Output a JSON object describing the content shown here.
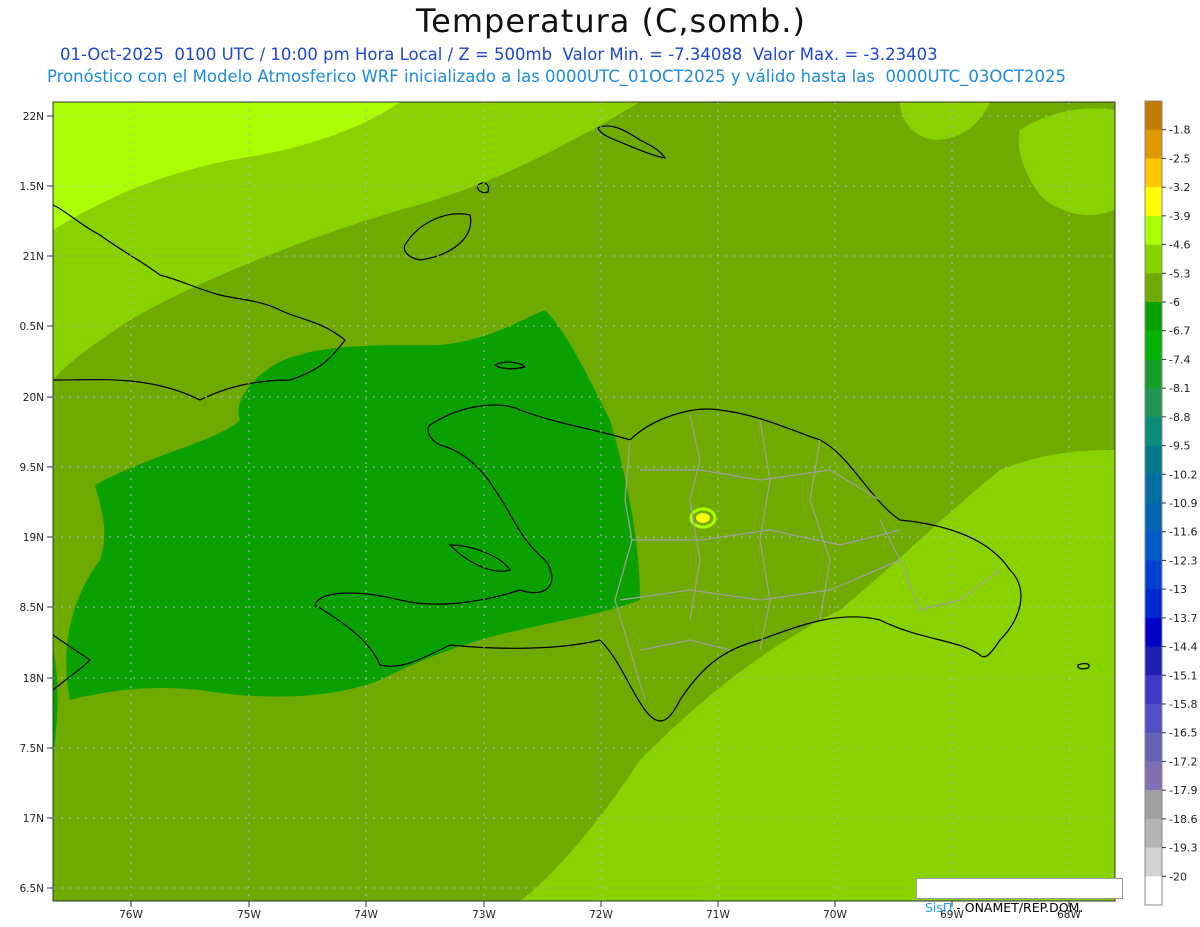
{
  "header": {
    "title": "Temperatura (C,somb.)",
    "line1": "01-Oct-2025  0100 UTC / 10:00 pm Hora Local / Z = 500mb  Valor Min. = -7.34088  Valor Max. = -3.23403",
    "line2": "Pronóstico con el Modelo Atmosferico WRF inicializado a las 0000UTC_01OCT2025 y válido hasta las  0000UTC_03OCT2025"
  },
  "lat_labels": [
    "22N",
    "1.5N",
    "21N",
    "0.5N",
    "20N",
    "9.5N",
    "19N",
    "8.5N",
    "18N",
    "7.5N",
    "17N",
    "6.5N"
  ],
  "lon_labels": [
    "76W",
    "75W",
    "74W",
    "73W",
    "72W",
    "71W",
    "70W",
    "69W",
    "68W"
  ],
  "colorbar": {
    "labels": [
      "-1.8",
      "-2.5",
      "-3.2",
      "-3.9",
      "-4.6",
      "-5.3",
      "-6",
      "-6.7",
      "-7.4",
      "-8.1",
      "-8.8",
      "-9.5",
      "-10.2",
      "-10.9",
      "-11.6",
      "-12.3",
      "-13",
      "-13.7",
      "-14.4",
      "-15.1",
      "-15.8",
      "-16.5",
      "-17.2",
      "-17.9",
      "-18.6",
      "-19.3",
      "-20"
    ],
    "colors": [
      "#c07c00",
      "#e09800",
      "#ffc800",
      "#ffff00",
      "#aaff00",
      "#88d200",
      "#6eaa00",
      "#0aa000",
      "#00b400",
      "#14a028",
      "#1e9650",
      "#0a8c78",
      "#00788c",
      "#006ea0",
      "#0064b4",
      "#005ac8",
      "#0041d2",
      "#0028d2",
      "#0000c8",
      "#1e1eb4",
      "#3c3cc8",
      "#5050c8",
      "#6464b4",
      "#8270b4",
      "#a0a0a0",
      "#b4b4b4",
      "#d2d2d2",
      "#ffffff"
    ]
  },
  "credit": {
    "brand": "SisΠ",
    "org": " - ONAMET/REP.DOM."
  },
  "field_colors": {
    "warmest": "#aaff00",
    "light": "#88d200",
    "mid": "#6eaa00",
    "cool": "#0aa000",
    "hotspot": "#ffff00",
    "coast": "#000000",
    "borders": "#a0a0a0"
  }
}
